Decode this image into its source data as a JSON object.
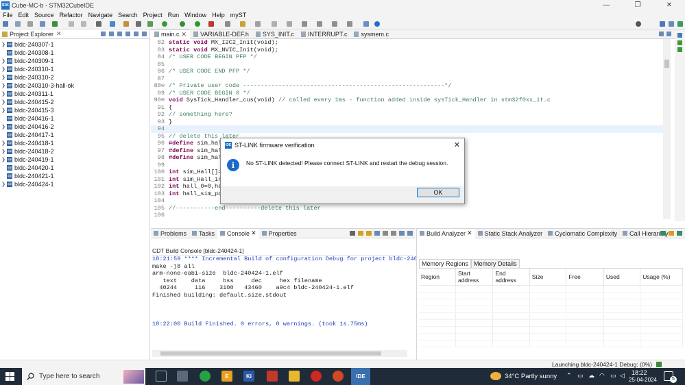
{
  "window": {
    "app_icon": "IDE",
    "title": "Cube-MC-b - STM32CubeIDE",
    "controls": [
      "—",
      "❐",
      "✕"
    ]
  },
  "menu": [
    "File",
    "Edit",
    "Source",
    "Refactor",
    "Navigate",
    "Search",
    "Project",
    "Run",
    "Window",
    "Help",
    "myST"
  ],
  "explorer": {
    "title": "Project Explorer",
    "projects": [
      {
        "name": "bldc-240307-1",
        "expandable": true
      },
      {
        "name": "bldc-240308-1",
        "expandable": false
      },
      {
        "name": "bldc-240309-1",
        "expandable": true
      },
      {
        "name": "bldc-240310-1",
        "expandable": true
      },
      {
        "name": "bldc-240310-2",
        "expandable": true
      },
      {
        "name": "bldc-240310-3-hall-ok",
        "expandable": true
      },
      {
        "name": "bldc-240311-1",
        "expandable": true
      },
      {
        "name": "bldc-240415-2",
        "expandable": true
      },
      {
        "name": "bldc-240415-3",
        "expandable": true
      },
      {
        "name": "bldc-240416-1",
        "expandable": false
      },
      {
        "name": "bldc-240416-2",
        "expandable": true
      },
      {
        "name": "bldc-240417-1",
        "expandable": false
      },
      {
        "name": "bldc-240418-1",
        "expandable": true
      },
      {
        "name": "bldc-240418-2",
        "expandable": true
      },
      {
        "name": "bldc-240419-1",
        "expandable": true
      },
      {
        "name": "bldc-240420-1",
        "expandable": false
      },
      {
        "name": "bldc-240421-1",
        "expandable": false
      },
      {
        "name": "bldc-240424-1",
        "expandable": true
      }
    ]
  },
  "editor_tabs": [
    {
      "label": "main.c",
      "close": "✕",
      "active": true
    },
    {
      "label": "VARIABLE-DEF.h",
      "close": "",
      "active": false
    },
    {
      "label": "SYS_INIT.c",
      "close": "",
      "active": false
    },
    {
      "label": "INTERRUPT.c",
      "close": "",
      "active": false
    },
    {
      "label": "sysmem.c",
      "close": "",
      "active": false
    }
  ],
  "code_lines": [
    {
      "n": "82",
      "html": "<span class=\"kw\">static void</span> MX_I2C2_Init(void);"
    },
    {
      "n": "83",
      "html": "<span class=\"kw\">static void</span> MX_NVIC_Init(void);"
    },
    {
      "n": "84",
      "html": "<span class=\"cm\">/* USER CODE BEGIN PFP */</span>"
    },
    {
      "n": "85",
      "html": ""
    },
    {
      "n": "86",
      "html": "<span class=\"cm\">/* USER CODE END PFP */</span>"
    },
    {
      "n": "87",
      "html": ""
    },
    {
      "n": "88⊖",
      "html": "<span class=\"cm\">/* Private user code ---------------------------------------------------------*/</span>"
    },
    {
      "n": "89",
      "html": "<span class=\"cm\">/* USER CODE BEGIN 0 */</span>"
    },
    {
      "n": "90⊖",
      "html": "<span class=\"kw\">void</span> SysTick_Handler_cus(void) <span class=\"cm\">// called every 1ms - function added inside sysTick_Handler in stm32f0xx_it.c</span>"
    },
    {
      "n": "91",
      "html": "{"
    },
    {
      "n": "92",
      "html": "<span class=\"cm\">// something here?</span>"
    },
    {
      "n": "93",
      "html": "}"
    },
    {
      "n": "94",
      "html": ""
    },
    {
      "n": "95",
      "html": "<span class=\"cm\">// delete this later</span>"
    },
    {
      "n": "96",
      "html": "<span class=\"kw\">#define</span> sim_hal"
    },
    {
      "n": "97",
      "html": "<span class=\"kw\">#define</span> sim_hal"
    },
    {
      "n": "98",
      "html": "<span class=\"kw\">#define</span> sim_hal"
    },
    {
      "n": "99",
      "html": ""
    },
    {
      "n": "100",
      "html": "<span class=\"kw\">int</span> sim_Hall[]="
    },
    {
      "n": "101",
      "html": "<span class=\"kw\">int</span> sim_Hall_in"
    },
    {
      "n": "102",
      "html": "<span class=\"kw\">int</span> hall_0=0,ha"
    },
    {
      "n": "103",
      "html": "<span class=\"kw\">int</span> hall_sim_pc"
    },
    {
      "n": "104",
      "html": ""
    },
    {
      "n": "105",
      "html": "<span class=\"cm\">//-----------end----------delete this later</span>"
    },
    {
      "n": "106",
      "html": ""
    }
  ],
  "dialog": {
    "app_icon": "IDE",
    "title": "ST-LINK firmware verification",
    "close_glyph": "✕",
    "info_glyph": "i",
    "message": "No ST-LINK detected! Please connect ST-LINK and restart the debug session.",
    "ok_label": "OK"
  },
  "console_panel": {
    "tabs": [
      {
        "label": "Problems",
        "active": false
      },
      {
        "label": "Tasks",
        "active": false
      },
      {
        "label": "Console",
        "active": true,
        "close": "✕"
      },
      {
        "label": "Properties",
        "active": false
      }
    ],
    "header": "CDT Build Console [bldc-240424-1]",
    "lines": [
      {
        "text": "18:21:59 **** Incremental Build of configuration Debug for project bldc-240424-",
        "blue": true
      },
      {
        "text": "make -j8 all",
        "blue": false
      },
      {
        "text": "arm-none-eabi-size  bldc-240424-1.elf",
        "blue": false
      },
      {
        "text": "   text    data     bss     dec     hex filename",
        "blue": false
      },
      {
        "text": "  40244     116    3100   43460    a9c4 bldc-240424-1.elf",
        "blue": false
      },
      {
        "text": "Finished building: default.size.stdout",
        "blue": false
      },
      {
        "text": " ",
        "blue": false
      },
      {
        "text": " ",
        "blue": false
      },
      {
        "text": " ",
        "blue": false
      },
      {
        "text": "18:22:00 Build Finished. 0 errors, 0 warnings. (took 1s.75ms)",
        "blue": true
      }
    ]
  },
  "build_panel": {
    "tabs": [
      {
        "label": "Build Analyzer",
        "active": true,
        "close": "✕"
      },
      {
        "label": "Static Stack Analyzer",
        "active": false
      },
      {
        "label": "Cyclomatic Complexity",
        "active": false
      },
      {
        "label": "Call Hierarchy",
        "active": false
      }
    ],
    "subtabs": [
      "Memory Regions",
      "Memory Details"
    ],
    "columns": [
      "Region",
      "Start address",
      "End address",
      "Size",
      "Free",
      "Used",
      "Usage (%)"
    ]
  },
  "status": {
    "launch": "Launching bldc-240424-1 Debug: (0%)"
  },
  "taskbar": {
    "search_placeholder": "Type here to search",
    "weather": "34°C  Partly sunny",
    "time": "18:22",
    "date": "25-04-2024",
    "ide_label": "IDE",
    "ki_label": "Ki",
    "e_label": "E",
    "notification_count": "5"
  },
  "colors": {
    "keyword": "#7f0055",
    "comment": "#3f7f5f",
    "console_blue": "#1f3fbf",
    "taskbar": "#1f2b38",
    "accent": "#0078d7"
  }
}
